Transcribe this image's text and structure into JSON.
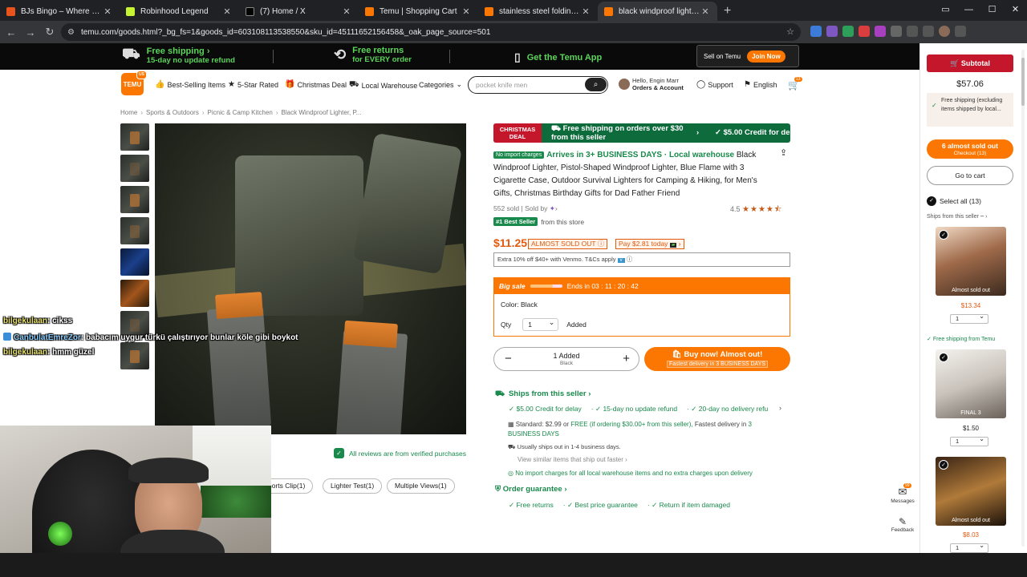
{
  "browser": {
    "tabs": [
      {
        "title": "BJs Bingo – Where the Locals W",
        "color": "#e8541b",
        "active": false
      },
      {
        "title": "Robinhood Legend",
        "color": "#c6f432",
        "active": false
      },
      {
        "title": "(7) Home / X",
        "color": "#222222",
        "active": false
      },
      {
        "title": "Temu | Shopping Cart",
        "color": "#fb7701",
        "active": false
      },
      {
        "title": "stainless steel folding wrap mu",
        "color": "#fb7701",
        "active": false
      },
      {
        "title": "black windproof lighter, pistol-",
        "color": "#fb7701",
        "active": true
      }
    ],
    "url": "temu.com/goods.html?_bg_fs=1&goods_id=603108113538550&sku_id=45111652156458&_oak_page_source=501"
  },
  "promo": {
    "free_shipping": "Free shipping",
    "free_shipping_sub": "15-day no update refund",
    "free_returns": "Free returns",
    "free_returns_sub": "for EVERY order",
    "app": "Get the Temu App",
    "sell": "Sell on Temu",
    "join": "Join Now"
  },
  "header": {
    "logo": "TEMU",
    "nav": [
      "Best-Selling Items",
      "5-Star Rated",
      "Christmas Deal",
      "Local Warehouse",
      "Categories"
    ],
    "search_placeholder": "pocket knife men",
    "account_line1": "Hello, Engin Marr",
    "account_line2": "Orders & Account",
    "support": "Support",
    "language": "English",
    "cart_count": "13"
  },
  "breadcrumb": [
    "Home",
    "Sports & Outdoors",
    "Picnic & Camp Kitchen",
    "Black Windproof Lighter, P..."
  ],
  "product": {
    "deal_tag": "CHRISTMAS DEAL",
    "deal_text": "Free shipping on orders over $30 from this seller",
    "deal_credit": "$5.00 Credit for de",
    "no_import": "No import charges",
    "arrives": "Arrives in 3+ BUSINESS DAYS · Local warehouse",
    "title": "Black Windproof Lighter, Pistol-Shaped Windproof Lighter, Blue Flame with 3 Cigarette Case, Outdoor Survival Lighters for Camping & Hiking, for Men's Gifts, Christmas Birthday Gifts for Dad Father Friend",
    "sold": "552 sold | Sold by",
    "rating": "4.5",
    "rating_value": 4.5,
    "best_seller": "#1 Best Seller",
    "best_seller_from": "from this store",
    "price": "$11.25",
    "almost": "ALMOST SOLD OUT",
    "pay": "Pay $2.81 today",
    "extra": "Extra 10% off $40+ with Venmo. T&Cs apply",
    "big_sale": "Big sale",
    "ends": "Ends in 03 : 11 : 20 : 42",
    "color": "Color: Black",
    "qty_label": "Qty",
    "qty_value": "1",
    "added": "Added",
    "stepper_added": "1 Added",
    "stepper_color": "Black",
    "buy_now": "Buy now! Almost out!",
    "buy_sub": "Fastest delivery in 3 BUSINESS DAYS",
    "reviews_verified": "All reviews are from verified purchases",
    "review_chips": [
      "horts Clip(1)",
      "Lighter Test(1)",
      "Multiple Views(1)"
    ]
  },
  "shipping": {
    "ships_from": "Ships from this seller",
    "perks": [
      "$5.00 Credit for delay",
      "15-day no update refund",
      "20-day no delivery refu"
    ],
    "standard": "Standard: $2.99 or",
    "standard_free": "FREE (if ordering $30.00+ from this seller),",
    "standard_fast": "Fastest delivery in",
    "standard_days": "3 BUSINESS DAYS",
    "usually": "Usually ships out in 1-4 business days.",
    "view_similar": "View similar items that ship out faster",
    "no_import_note": "No import charges for all local warehouse items and no extra charges upon delivery",
    "order_guarantee": "Order guarantee",
    "guarantee_perks": [
      "Free returns",
      "Best price guarantee",
      "Return if item damaged"
    ]
  },
  "floating": {
    "messages": "Messages",
    "messages_badge": "99",
    "feedback": "Feedback"
  },
  "cart": {
    "subtotal_label": "Subtotal",
    "subtotal": "$57.06",
    "free_shipping_note": "Free shipping (excluding items shipped by local...",
    "checkout": "6 almost sold out",
    "checkout_sub": "Checkout (13)",
    "go_to_cart": "Go to cart",
    "select_all": "Select all (13)",
    "ships_from_seller": "Ships from this seller",
    "free_from_temu": "Free shipping from Temu",
    "items": [
      {
        "price": "$13.34",
        "qty": "1",
        "tag": "Almost sold out",
        "price_color": "#e15a10"
      },
      {
        "price": "$1.50",
        "qty": "1",
        "tag": "FINAL 3",
        "price_color": "#222222"
      },
      {
        "price": "$8.03",
        "qty": "1",
        "tag": "Almost sold out",
        "price_color": "#e15a10"
      }
    ]
  },
  "stream_chat": [
    {
      "user": "bilgekulaan",
      "msg": ": cikss"
    },
    {
      "user": "CanbulatEmreZor",
      "msg": ": babacım uygur türkü çalıştırıyor bunlar köle gibi boykot"
    },
    {
      "user": "bilgekulaan",
      "msg": ": hmm güzel"
    }
  ],
  "colors": {
    "accent": "#fb7701",
    "green": "#19894c",
    "red": "#c5172b",
    "price": "#e15a10"
  }
}
